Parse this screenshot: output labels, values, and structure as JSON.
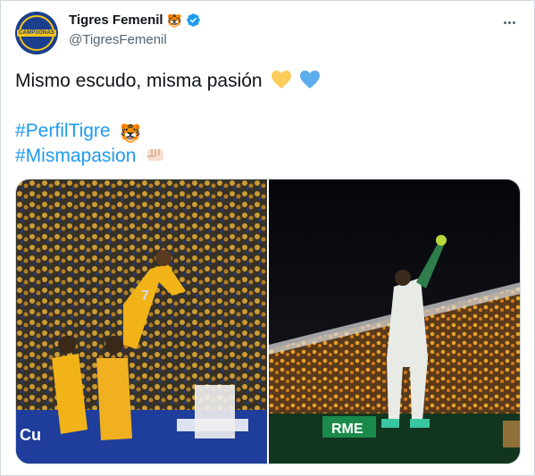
{
  "tweet": {
    "display_name": "Tigres Femenil",
    "name_emoji": "🐯",
    "handle": "@TigresFemenil",
    "avatar_badge": "CAMP3ONAS",
    "line1": "Mismo escudo, misma pasión",
    "line1_emojis": [
      "yellow-heart-icon",
      "blue-heart-icon"
    ],
    "hashtag1": "#PerfilTigre",
    "hashtag1_emoji": "🐯",
    "hashtag2": "#Mismapasion",
    "hashtag2_emoji": "fist-icon"
  },
  "media": {
    "photo1": {
      "description_icon": "players-celebrating-photo",
      "jersey_number": "7",
      "banner_text": "Cu"
    },
    "photo2": {
      "description_icon": "goalkeeper-celebrating-photo",
      "banner_text": "RME"
    }
  },
  "colors": {
    "accent": "#1d9bf0",
    "text": "#0f1419",
    "secondary": "#536471",
    "tigres_gold": "#f5b800",
    "tigres_blue": "#1a3f8f"
  }
}
